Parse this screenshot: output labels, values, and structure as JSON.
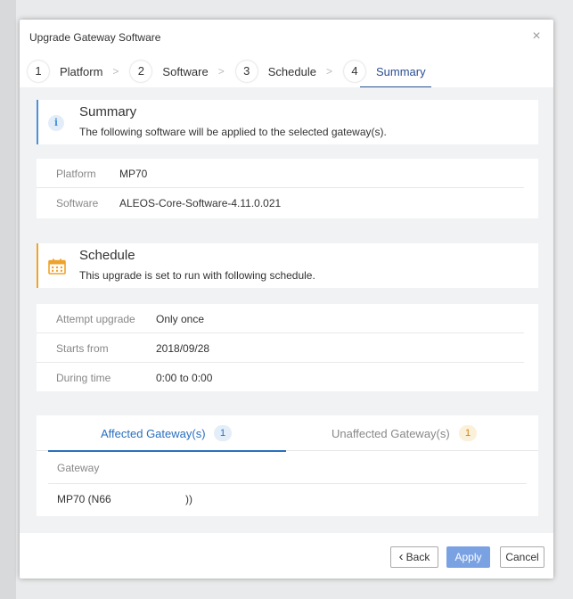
{
  "dialog": {
    "title": "Upgrade Gateway Software",
    "close_glyph": "×"
  },
  "steps": [
    {
      "num": "1",
      "label": "Platform"
    },
    {
      "num": "2",
      "label": "Software"
    },
    {
      "num": "3",
      "label": "Schedule"
    },
    {
      "num": "4",
      "label": "Summary"
    }
  ],
  "active_step": 4,
  "summary_banner": {
    "icon": "info-icon",
    "icon_glyph": "i",
    "title": "Summary",
    "text": "The following software will be applied to the selected gateway(s)."
  },
  "summary_details": [
    {
      "key": "Platform",
      "value": "MP70"
    },
    {
      "key": "Software",
      "value": "ALEOS-Core-Software-4.11.0.021"
    }
  ],
  "schedule_banner": {
    "icon": "calendar-icon",
    "title": "Schedule",
    "text": "This upgrade is set to run with following schedule."
  },
  "schedule_details": [
    {
      "key": "Attempt upgrade",
      "value": "Only once"
    },
    {
      "key": "Starts from",
      "value": "2018/09/28"
    },
    {
      "key": "During time",
      "value": "0:00 to 0:00"
    }
  ],
  "tabs": [
    {
      "label": "Affected Gateway(s)",
      "count": "1"
    },
    {
      "label": "Unaffected Gateway(s)",
      "count": "1"
    }
  ],
  "gateway_table": {
    "header": "Gateway",
    "rows": [
      {
        "name": "MP70 (N66",
        "suffix": "))"
      }
    ]
  },
  "footer": {
    "back_label": "Back",
    "back_glyph": "‹",
    "apply_label": "Apply",
    "cancel_label": "Cancel"
  },
  "colors": {
    "accent": "#2a4f93",
    "tab_accent": "#2a6fbf",
    "info": "#4a90d9",
    "warning": "#f0a32a",
    "apply_button": "#7aa2e3"
  }
}
